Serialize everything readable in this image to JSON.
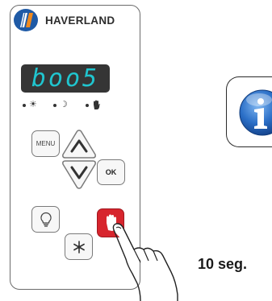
{
  "brand": {
    "name": "HAVERLAND"
  },
  "display": {
    "value": "boo5"
  },
  "indicators": [
    {
      "icon": "sun-icon"
    },
    {
      "icon": "moon-icon"
    },
    {
      "icon": "hand-icon"
    }
  ],
  "keys": {
    "menu_label": "MENU",
    "ok_label": "OK"
  },
  "instruction": {
    "duration": "10 seg."
  },
  "colors": {
    "display_bg": "#353535",
    "display_text": "#20c5cf",
    "stop_key": "#d7252d",
    "logo_blue": "#1f5aa6",
    "logo_orange": "#f08a1e",
    "info_blue": "#1e63b8"
  }
}
